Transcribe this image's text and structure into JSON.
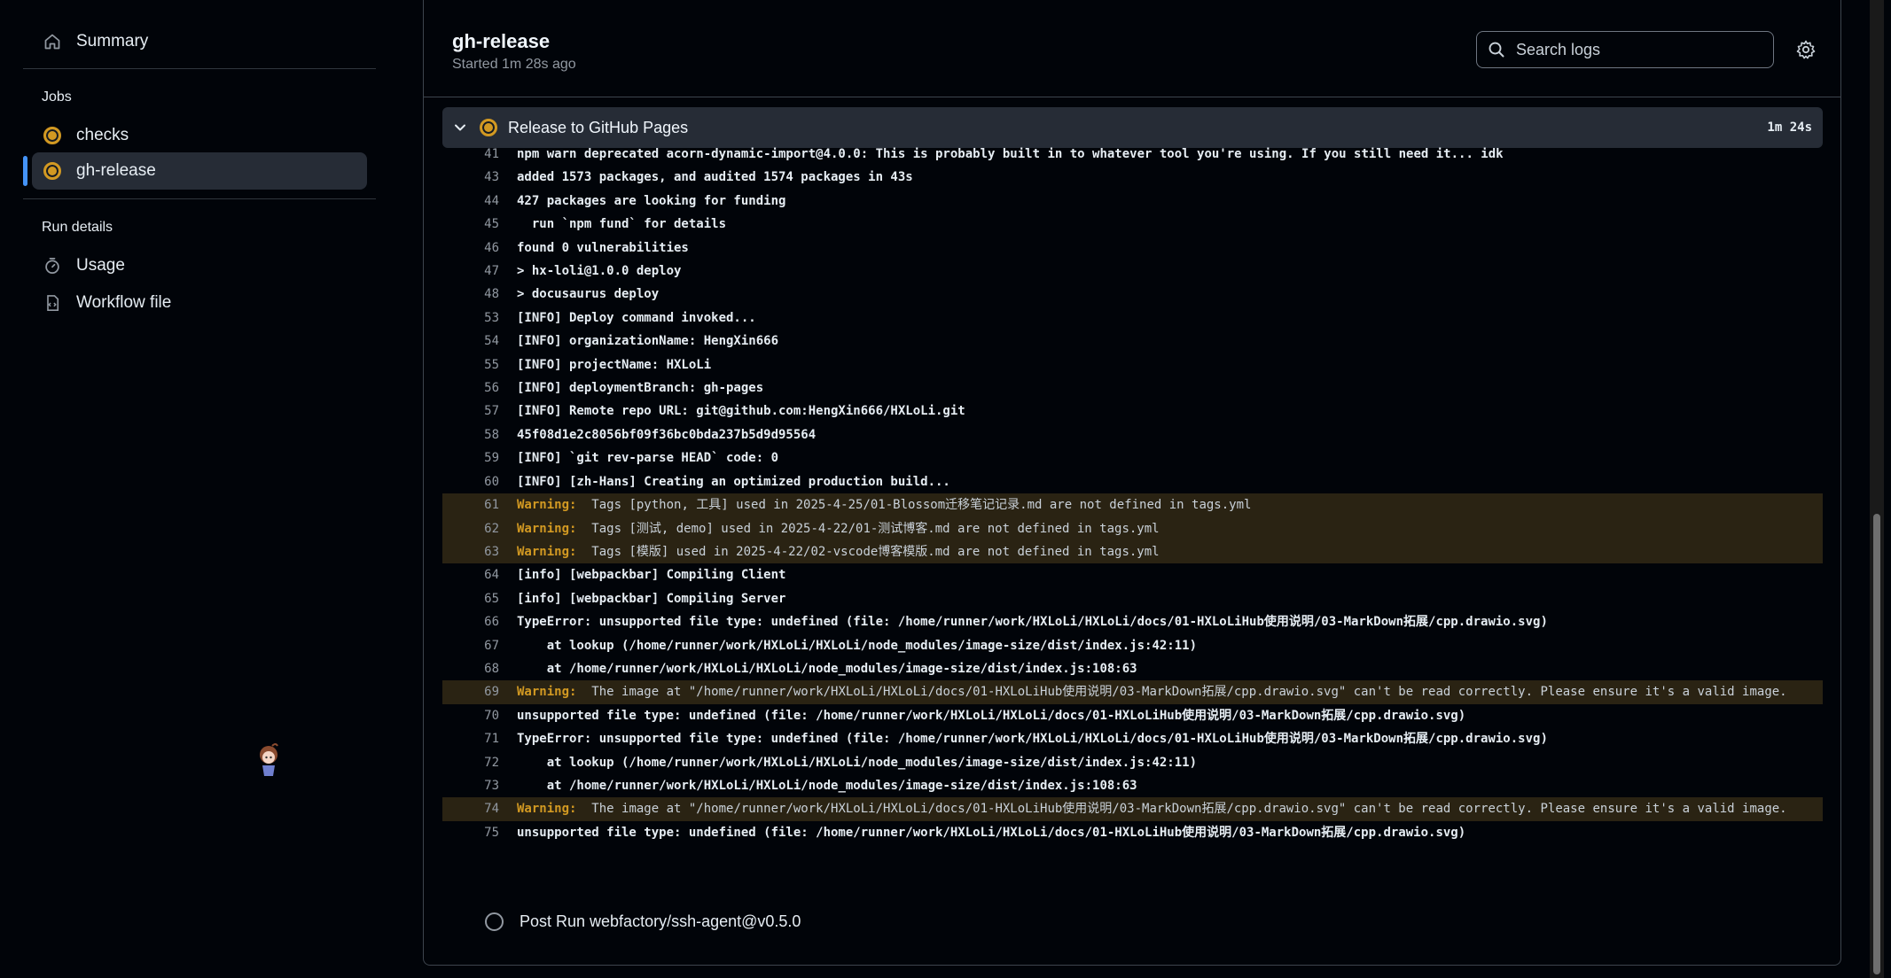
{
  "sidebar": {
    "summary_label": "Summary",
    "jobs_heading": "Jobs",
    "jobs": [
      {
        "label": "checks",
        "status": "in-progress"
      },
      {
        "label": "gh-release",
        "status": "in-progress",
        "selected": true
      }
    ],
    "run_details_heading": "Run details",
    "run_details": [
      {
        "label": "Usage",
        "icon": "stopwatch-icon"
      },
      {
        "label": "Workflow file",
        "icon": "file-code-icon"
      }
    ]
  },
  "header": {
    "job_title": "gh-release",
    "started": "Started 1m 28s ago",
    "search_placeholder": "Search logs"
  },
  "step": {
    "name": "Release to GitHub Pages",
    "duration": "1m 24s",
    "status": "in-progress"
  },
  "log_lines": [
    {
      "n": "41",
      "text": "npm warn deprecated acorn-dynamic-import@4.0.0: This is probably built in to whatever tool you're using. If you still need it... idk"
    },
    {
      "n": "43",
      "text": "added 1573 packages, and audited 1574 packages in 43s"
    },
    {
      "n": "44",
      "text": "427 packages are looking for funding"
    },
    {
      "n": "45",
      "text": "  run `npm fund` for details"
    },
    {
      "n": "46",
      "text": "found 0 vulnerabilities"
    },
    {
      "n": "47",
      "text": "> hx-loli@1.0.0 deploy"
    },
    {
      "n": "48",
      "text": "> docusaurus deploy"
    },
    {
      "n": "53",
      "text": "[INFO] Deploy command invoked..."
    },
    {
      "n": "54",
      "text": "[INFO] organizationName: HengXin666"
    },
    {
      "n": "55",
      "text": "[INFO] projectName: HXLoLi"
    },
    {
      "n": "56",
      "text": "[INFO] deploymentBranch: gh-pages"
    },
    {
      "n": "57",
      "text": "[INFO] Remote repo URL: git@github.com:HengXin666/HXLoLi.git"
    },
    {
      "n": "58",
      "text": "45f08d1e2c8056bf09f36bc0bda237b5d9d95564"
    },
    {
      "n": "59",
      "text": "[INFO] `git rev-parse HEAD` code: 0"
    },
    {
      "n": "60",
      "text": "[INFO] [zh-Hans] Creating an optimized production build..."
    },
    {
      "n": "61",
      "warning": "Warning:",
      "text": "Tags [python, 工具] used in 2025-4-25/01-Blossom迁移笔记记录.md are not defined in tags.yml"
    },
    {
      "n": "62",
      "warning": "Warning:",
      "text": "Tags [测试, demo] used in 2025-4-22/01-测试博客.md are not defined in tags.yml"
    },
    {
      "n": "63",
      "warning": "Warning:",
      "text": "Tags [模版] used in 2025-4-22/02-vscode博客模版.md are not defined in tags.yml"
    },
    {
      "n": "64",
      "text": "[info] [webpackbar] Compiling Client"
    },
    {
      "n": "65",
      "text": "[info] [webpackbar] Compiling Server"
    },
    {
      "n": "66",
      "text": "TypeError: unsupported file type: undefined (file: /home/runner/work/HXLoLi/HXLoLi/docs/01-HXLoLiHub使用说明/03-MarkDown拓展/cpp.drawio.svg)"
    },
    {
      "n": "67",
      "text": "    at lookup (/home/runner/work/HXLoLi/HXLoLi/node_modules/image-size/dist/index.js:42:11)"
    },
    {
      "n": "68",
      "text": "    at /home/runner/work/HXLoLi/HXLoLi/node_modules/image-size/dist/index.js:108:63"
    },
    {
      "n": "69",
      "warning": "Warning:",
      "text": "The image at \"/home/runner/work/HXLoLi/HXLoLi/docs/01-HXLoLiHub使用说明/03-MarkDown拓展/cpp.drawio.svg\" can't be read correctly. Please ensure it's a valid image."
    },
    {
      "n": "70",
      "text": "unsupported file type: undefined (file: /home/runner/work/HXLoLi/HXLoLi/docs/01-HXLoLiHub使用说明/03-MarkDown拓展/cpp.drawio.svg)"
    },
    {
      "n": "71",
      "text": "TypeError: unsupported file type: undefined (file: /home/runner/work/HXLoLi/HXLoLi/docs/01-HXLoLiHub使用说明/03-MarkDown拓展/cpp.drawio.svg)"
    },
    {
      "n": "72",
      "text": "    at lookup (/home/runner/work/HXLoLi/HXLoLi/node_modules/image-size/dist/index.js:42:11)"
    },
    {
      "n": "73",
      "text": "    at /home/runner/work/HXLoLi/HXLoLi/node_modules/image-size/dist/index.js:108:63"
    },
    {
      "n": "74",
      "warning": "Warning:",
      "text": "The image at \"/home/runner/work/HXLoLi/HXLoLi/docs/01-HXLoLiHub使用说明/03-MarkDown拓展/cpp.drawio.svg\" can't be read correctly. Please ensure it's a valid image."
    },
    {
      "n": "75",
      "text": "unsupported file type: undefined (file: /home/runner/work/HXLoLi/HXLoLi/docs/01-HXLoLiHub使用说明/03-MarkDown拓展/cpp.drawio.svg)"
    }
  ],
  "post_step": {
    "label": "Post Run webfactory/ssh-agent@v0.5.0",
    "status": "pending"
  },
  "colors": {
    "background": "#010409",
    "warning": "#d29922",
    "in_progress": "#d29922",
    "active_accent": "#4493f8"
  }
}
